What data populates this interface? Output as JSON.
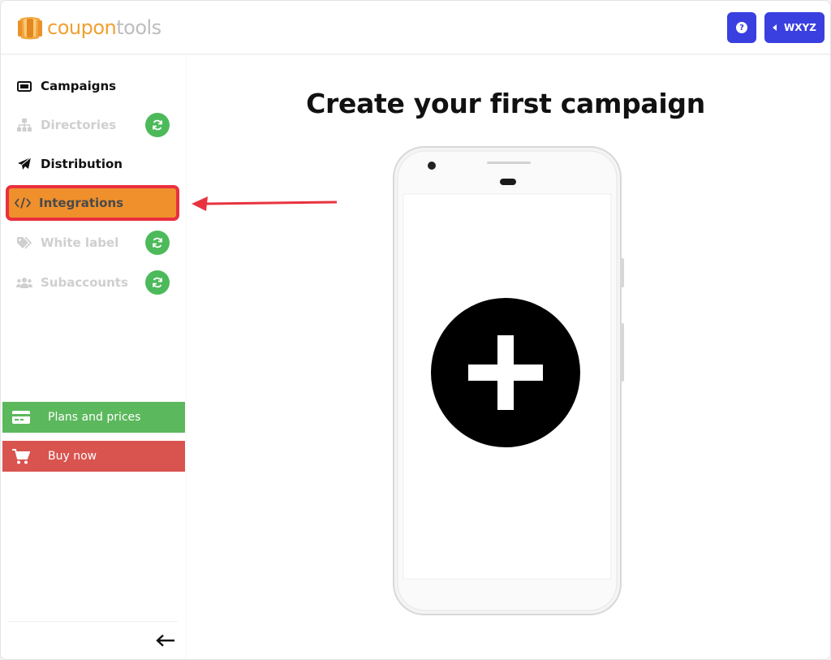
{
  "header": {
    "logo_text_part1": "coupon",
    "logo_text_part2": "tools",
    "help_label": "?",
    "user_label": "WXYZ"
  },
  "sidebar": {
    "items": [
      {
        "label": "Campaigns",
        "icon": "ticket-icon",
        "state": "active"
      },
      {
        "label": "Directories",
        "icon": "sitemap-icon",
        "state": "disabled",
        "badge": "refresh-icon"
      },
      {
        "label": "Distribution",
        "icon": "paper-plane-icon",
        "state": "active"
      },
      {
        "label": "Integrations",
        "icon": "code-icon",
        "state": "highlighted"
      },
      {
        "label": "White label",
        "icon": "tags-icon",
        "state": "disabled",
        "badge": "refresh-icon"
      },
      {
        "label": "Subaccounts",
        "icon": "users-icon",
        "state": "disabled",
        "badge": "refresh-icon"
      }
    ],
    "plans_label": "Plans and prices",
    "buy_label": "Buy now"
  },
  "main": {
    "title": "Create your first campaign"
  },
  "colors": {
    "accent": "#3a3fe0",
    "integrations_bg": "#f0902c",
    "highlight_border": "#ea2f3f",
    "plans_bg": "#5cb85c",
    "buy_bg": "#d9534f",
    "badge_green": "#4cba5a",
    "logo_orange": "#f0a030"
  }
}
